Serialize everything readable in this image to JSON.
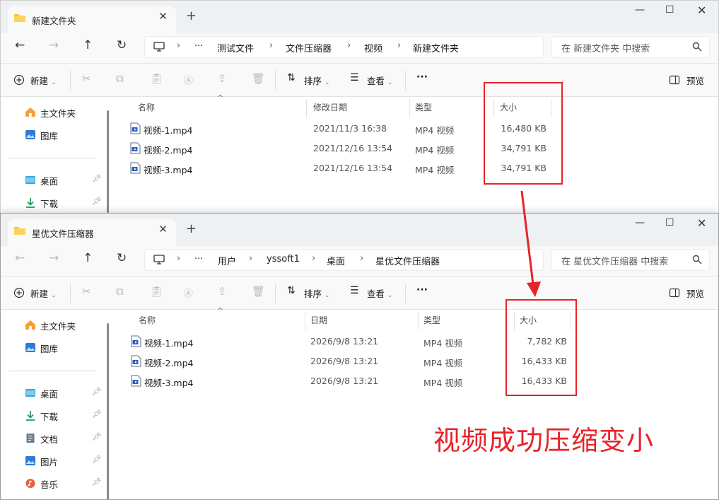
{
  "windows": [
    {
      "tab_title": "新建文件夹",
      "breadcrumb": [
        "测试文件",
        "文件压缩器",
        "视频",
        "新建文件夹"
      ],
      "search_placeholder": "在 新建文件夹 中搜索",
      "columns": [
        "名称",
        "修改日期",
        "类型",
        "大小"
      ],
      "rows": [
        {
          "name": "视频-1.mp4",
          "date": "2021/11/3 16:38",
          "type": "MP4 视频",
          "size": "16,480 KB"
        },
        {
          "name": "视频-2.mp4",
          "date": "2021/12/16 13:54",
          "type": "MP4 视频",
          "size": "34,791 KB"
        },
        {
          "name": "视频-3.mp4",
          "date": "2021/12/16 13:54",
          "type": "MP4 视频",
          "size": "34,791 KB"
        }
      ],
      "sidebar": [
        {
          "label": "主文件夹",
          "icon": "home-icon",
          "pinned": false
        },
        {
          "label": "图库",
          "icon": "gallery-icon",
          "pinned": false
        },
        {
          "label": "桌面",
          "icon": "desktop-icon",
          "pinned": true
        },
        {
          "label": "下载",
          "icon": "download-icon",
          "pinned": true
        }
      ]
    },
    {
      "tab_title": "星优文件压缩器",
      "breadcrumb": [
        "用户",
        "yssoft1",
        "桌面",
        "星优文件压缩器"
      ],
      "search_placeholder": "在 星优文件压缩器 中搜索",
      "columns": [
        "名称",
        "日期",
        "类型",
        "大小"
      ],
      "rows": [
        {
          "name": "视频-1.mp4",
          "date": "2026/9/8 13:21",
          "type": "MP4 视频",
          "size": "7,782 KB"
        },
        {
          "name": "视频-2.mp4",
          "date": "2026/9/8 13:21",
          "type": "MP4 视频",
          "size": "16,433 KB"
        },
        {
          "name": "视频-3.mp4",
          "date": "2026/9/8 13:21",
          "type": "MP4 视频",
          "size": "16,433 KB"
        }
      ],
      "sidebar": [
        {
          "label": "主文件夹",
          "icon": "home-icon",
          "pinned": false
        },
        {
          "label": "图库",
          "icon": "gallery-icon",
          "pinned": false
        },
        {
          "label": "桌面",
          "icon": "desktop-icon",
          "pinned": true
        },
        {
          "label": "下载",
          "icon": "download-icon",
          "pinned": true
        },
        {
          "label": "文档",
          "icon": "document-icon",
          "pinned": true
        },
        {
          "label": "图片",
          "icon": "pictures-icon",
          "pinned": true
        },
        {
          "label": "音乐",
          "icon": "music-icon",
          "pinned": true
        }
      ]
    }
  ],
  "toolbar": {
    "new_label": "新建",
    "sort_label": "排序",
    "view_label": "查看",
    "more_label": "···",
    "preview_label": "预览"
  },
  "nav": {
    "ellipsis": "···"
  },
  "annotation": "视频成功压缩变小",
  "colors": {
    "highlight": "#e8232a",
    "accent": "#0067c0",
    "folder": "#f4c042"
  }
}
